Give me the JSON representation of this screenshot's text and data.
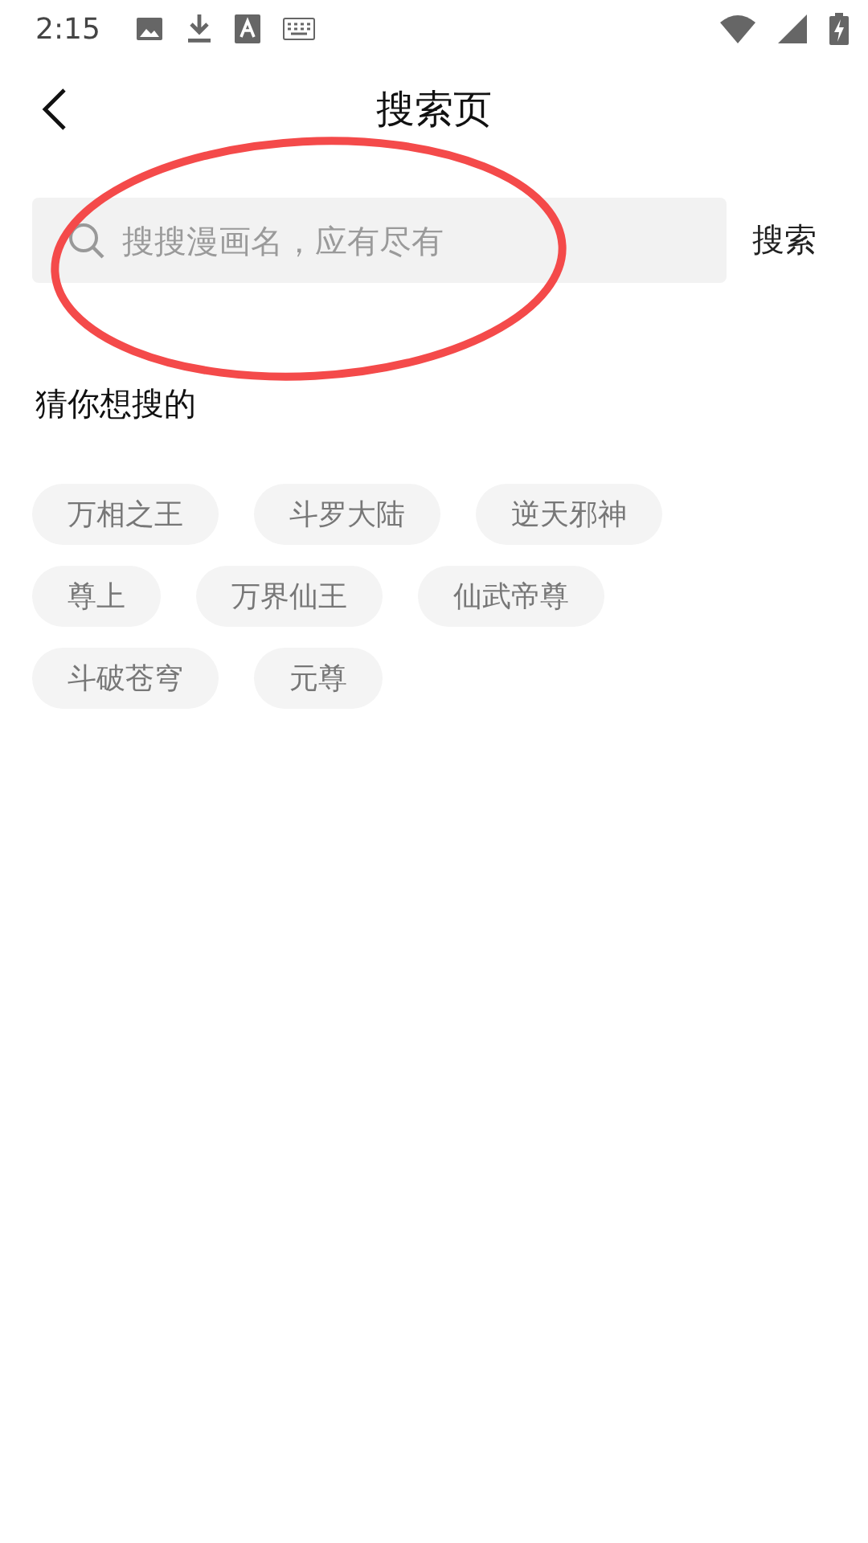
{
  "status_bar": {
    "time": "2:15"
  },
  "header": {
    "title": "搜索页"
  },
  "search": {
    "placeholder": "搜搜漫画名，应有尽有",
    "button": "搜索"
  },
  "annotation": {
    "kind": "ellipse"
  },
  "suggestions": {
    "title": "猜你想搜的",
    "tags": [
      "万相之王",
      "斗罗大陆",
      "逆天邪神",
      "尊上",
      "万界仙王",
      "仙武帝尊",
      "斗破苍穹",
      "元尊"
    ]
  }
}
